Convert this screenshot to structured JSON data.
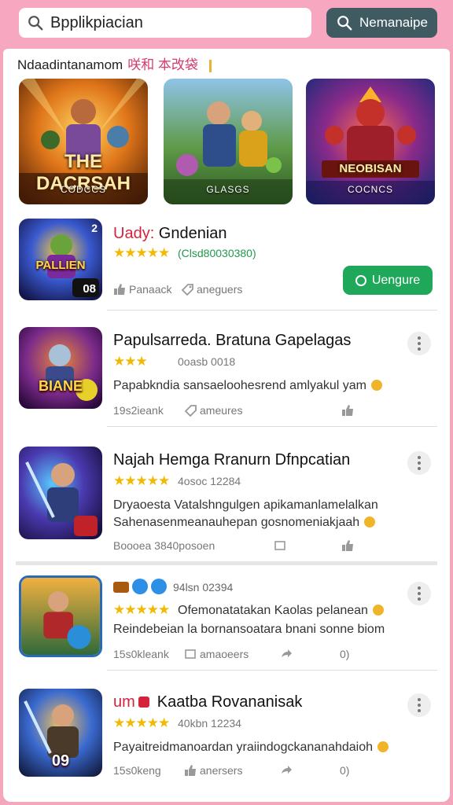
{
  "search": {
    "value": "Bpplikpiacian",
    "button_label": "Nemanaipe"
  },
  "section": {
    "title": "Ndaadintanamom",
    "title_cjk": "咲和 本改袋"
  },
  "banners": [
    {
      "title": "THE DACRSAH",
      "subtitle": "CODCCS"
    },
    {
      "title": "",
      "subtitle": "GLASGS"
    },
    {
      "title": "NEOBISAN",
      "subtitle": "COCNCS"
    }
  ],
  "featured": {
    "thumb_title": "PALLIEN",
    "thumb_badge": "08",
    "thumb_corner": "2",
    "title_highlight": "Uady:",
    "title_rest": " Gndenian",
    "stars": "★★★★★",
    "meta": "(Clsd80030380)",
    "foot1": "Panaack",
    "foot2": "aneguers",
    "button": "Uengure"
  },
  "apps": [
    {
      "title": "Papulsarreda. Bratuna Gapelagas",
      "stars": "★★★",
      "meta": "0oasb 0018",
      "desc1": "Papabkndia sansaeloohesrend amlyakul yam",
      "desc2": "",
      "foot1": "19s2ieank",
      "foot2": "ameures",
      "foot3": "",
      "foot4": "",
      "thumb_title": "BIANE"
    },
    {
      "title": "Najah Hemga Rranurn Dfnpcatian",
      "stars": "★★★★★",
      "meta": "4osoc 12284",
      "desc1": "Dryaoesta Vatalshngulgen apikamanlamelalkan",
      "desc2": "Sahenasenmeanauhepan gosnomeniakjaah",
      "foot1": "Boooea 3840posoen",
      "foot2": "",
      "foot3": "",
      "foot4": "",
      "thumb_title": ""
    },
    {
      "title": "94lsn 02394",
      "stars": "★★★★★",
      "meta": "",
      "desc1": "Ofemonatatakan Kaolas pelanean",
      "desc2": "Reindebeian la bornansoatara bnani sonne biom",
      "foot1": "15s0kleank",
      "foot2": "amaoeers",
      "foot3": "",
      "foot4": "0)",
      "thumb_title": ""
    },
    {
      "title_prefix": "um",
      "title": "Kaatba Rovananisak",
      "stars": "★★★★★",
      "meta": "40kbn 12234",
      "desc1": "Payaitreidmanoardan yraiindogckananahdaioh",
      "desc2": "",
      "foot1": "15s0keng",
      "foot2": "anersers",
      "foot3": "",
      "foot4": "0)",
      "thumb_title": "09"
    }
  ],
  "colors": {
    "header": "#f7a8c0",
    "accent": "#1fa85a",
    "search_button": "#3f5a61",
    "star": "#f2b900"
  }
}
